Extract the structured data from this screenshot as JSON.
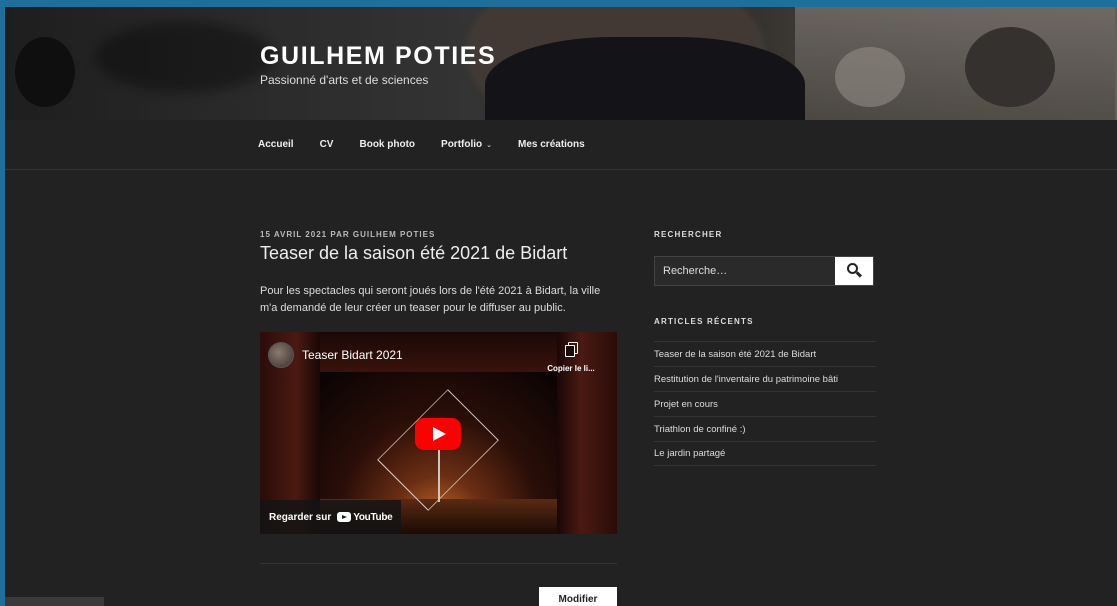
{
  "site": {
    "title": "GUILHEM POTIES",
    "description": "Passionné d'arts et de sciences"
  },
  "nav": {
    "items": [
      {
        "label": "Accueil"
      },
      {
        "label": "CV"
      },
      {
        "label": "Book photo"
      },
      {
        "label": "Portfolio",
        "has_submenu": true
      },
      {
        "label": "Mes créations"
      }
    ]
  },
  "post": {
    "meta": "15 AVRIL 2021 PAR GUILHEM POTIES",
    "title": "Teaser de la saison été 2021 de Bidart",
    "body": "Pour les spectacles qui seront joués lors de l'été 2021 à Bidart, la ville m'a demandé de leur créer un teaser pour le diffuser au public.",
    "video": {
      "title": "Teaser Bidart 2021",
      "copy_label": "Copier le li...",
      "watch_on": "Regarder sur",
      "platform": "YouTube"
    },
    "edit_label": "Modifier"
  },
  "sidebar": {
    "search": {
      "heading": "RECHERCHER",
      "placeholder": "Recherche…"
    },
    "recent": {
      "heading": "ARTICLES RÉCENTS",
      "items": [
        "Teaser de la saison été 2021 de Bidart",
        "Restitution de l'inventaire du patrimoine bâti",
        "Projet en cours",
        "Triathlon de confiné :)",
        "Le jardin partagé"
      ]
    }
  },
  "colors": {
    "background": "#222222",
    "frame": "#1e6f99",
    "youtube_red": "#ff0000"
  }
}
